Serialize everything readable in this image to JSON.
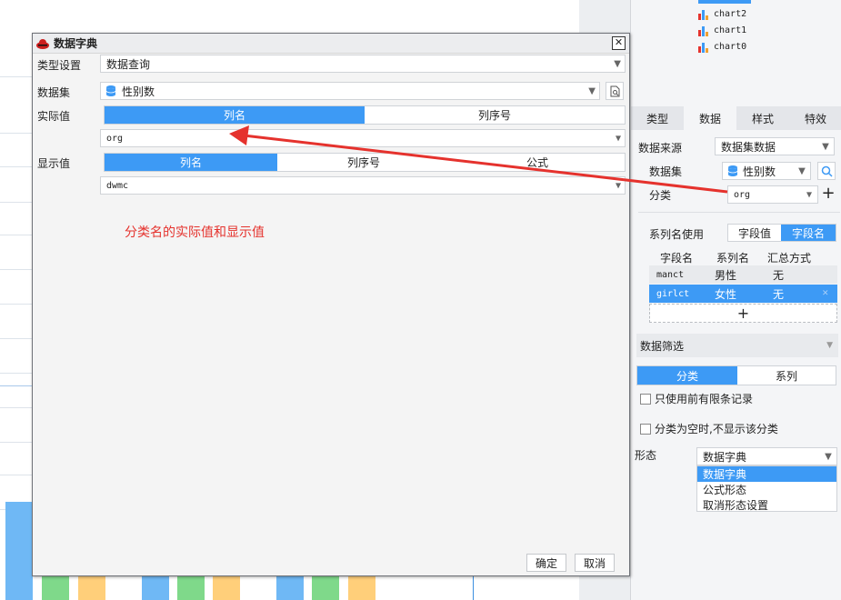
{
  "tree": {
    "items": [
      {
        "label": "chart2"
      },
      {
        "label": "chart1"
      },
      {
        "label": "chart0"
      }
    ]
  },
  "tabs": [
    {
      "label": "类型"
    },
    {
      "label": "数据"
    },
    {
      "label": "样式"
    },
    {
      "label": "特效"
    }
  ],
  "data_panel": {
    "source_label": "数据来源",
    "source_value": "数据集数据",
    "dataset_label": "数据集",
    "dataset_value": "性别数",
    "category_label": "分类",
    "category_value": "org",
    "series_name_label": "系列名使用",
    "series_name_options": [
      "字段值",
      "字段名"
    ],
    "table_headers": [
      "字段名",
      "系列名",
      "汇总方式"
    ],
    "table_rows": [
      {
        "field": "manct",
        "series": "男性",
        "summary": "无"
      },
      {
        "field": "girlct",
        "series": "女性",
        "summary": "无"
      }
    ],
    "add_symbol": "+",
    "filter_title": "数据筛选",
    "filter_tabs": [
      "分类",
      "系列"
    ],
    "checkbox_top_n": "只使用前有限条记录",
    "checkbox_hide_empty": "分类为空时,不显示该分类",
    "form_label": "形态",
    "form_value": "数据字典",
    "form_options": [
      "数据字典",
      "公式形态",
      "取消形态设置"
    ]
  },
  "dialog": {
    "title": "数据字典",
    "close_symbol": "✕",
    "type_label": "类型设置",
    "type_value": "数据查询",
    "dataset_label": "数据集",
    "dataset_value": "性别数",
    "actual_label": "实际值",
    "actual_tabs": [
      "列名",
      "列序号"
    ],
    "actual_value": "org",
    "display_label": "显示值",
    "display_tabs": [
      "列名",
      "列序号",
      "公式"
    ],
    "display_value": "dwmc",
    "annotation": "分类名的实际值和显示值",
    "ok_label": "确定",
    "cancel_label": "取消"
  },
  "colors": {
    "accent": "#3d9af5",
    "annotation": "#e5322d",
    "bar_blue": "#6fb8f5",
    "bar_green": "#7fd98a",
    "bar_orange": "#ffcf7a"
  },
  "icons": {
    "database": "database-icon",
    "search": "search-icon",
    "preview": "preview-icon",
    "plus": "plus-icon",
    "chart": "chart-icon"
  }
}
